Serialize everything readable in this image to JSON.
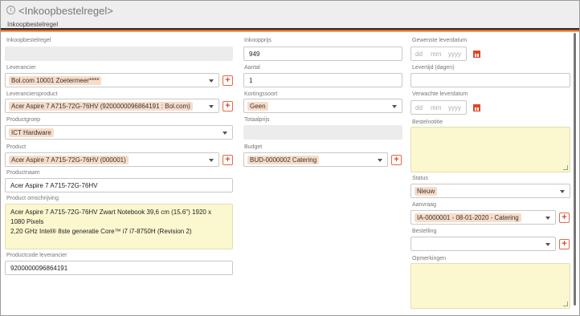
{
  "header": {
    "title": "<Inkoopbestelregel>",
    "section": "Inkoopbestelregel"
  },
  "col1": {
    "inkoopbestelregel": {
      "label": "Inkoopbestelregel",
      "value": ""
    },
    "leverancier": {
      "label": "Leverancier",
      "value": "Bol.com 10001 Zoetermeer****"
    },
    "leveranciersproduct": {
      "label": "Leveranciersproduct",
      "value": "Acer Aspire 7 A715-72G-76HV (9200000096864191 : Bol.com)"
    },
    "productgroep": {
      "label": "Productgroep",
      "value": "ICT Hardware"
    },
    "product": {
      "label": "Product",
      "value": "Acer Aspire 7 A715-72G-76HV (000001)"
    },
    "productnaam": {
      "label": "Productnaam",
      "value": "Acer Aspire 7 A715-72G-76HV"
    },
    "omschrijving": {
      "label": "Product omschrijving",
      "line1": "Acer Aspire 7 A715-72G-76HV Zwart Notebook 39,6 cm (15.6\") 1920 x 1080 Pixels",
      "line2": "2,20 GHz Intel® 8ste generatie Core™ i7 i7-8750H (Revision 2)"
    },
    "productcode": {
      "label": "Productcode leverancier",
      "value": "9200000096864191"
    }
  },
  "col2": {
    "inkoopprijs": {
      "label": "Inkoopprijs",
      "value": "949"
    },
    "aantal": {
      "label": "Aantal",
      "value": "1"
    },
    "kortingssoort": {
      "label": "Kortingssoort",
      "value": "Geen"
    },
    "totaalprijs": {
      "label": "Totaalprijs",
      "value": ""
    },
    "budget": {
      "label": "Budget",
      "value": "BUD-0000002 Catering"
    }
  },
  "col3": {
    "gewenste": {
      "label": "Gewenste leverdatum",
      "dd": "dd",
      "mm": "mm",
      "yyyy": "yyyy"
    },
    "levertijd": {
      "label": "Levertijd (dagen)",
      "value": ""
    },
    "verwachte": {
      "label": "Verwachte leverdatum",
      "dd": "dd",
      "mm": "mm",
      "yyyy": "yyyy"
    },
    "bestelnotitie": {
      "label": "Bestelnotitie",
      "value": ""
    },
    "status": {
      "label": "Status",
      "value": "Nieuw"
    },
    "aanvraag": {
      "label": "Aanvraag",
      "value": "IA-0000001 - 08-01-2020 - Catering"
    },
    "bestelling": {
      "label": "Bestelling",
      "value": ""
    },
    "opmerkingen": {
      "label": "Opmerkingen",
      "value": ""
    }
  },
  "icons": {
    "info": "i",
    "plus": "+",
    "calendar": "calendar-icon",
    "caret": "chevron-down-icon"
  },
  "colors": {
    "accent": "#e0452a",
    "stripe_dark": "#2b2b2b",
    "stripe_orange": "#e8623a",
    "stripe_yellow": "#f2c14a",
    "chip": "#f7dcc8",
    "note": "#fbf8d0"
  }
}
